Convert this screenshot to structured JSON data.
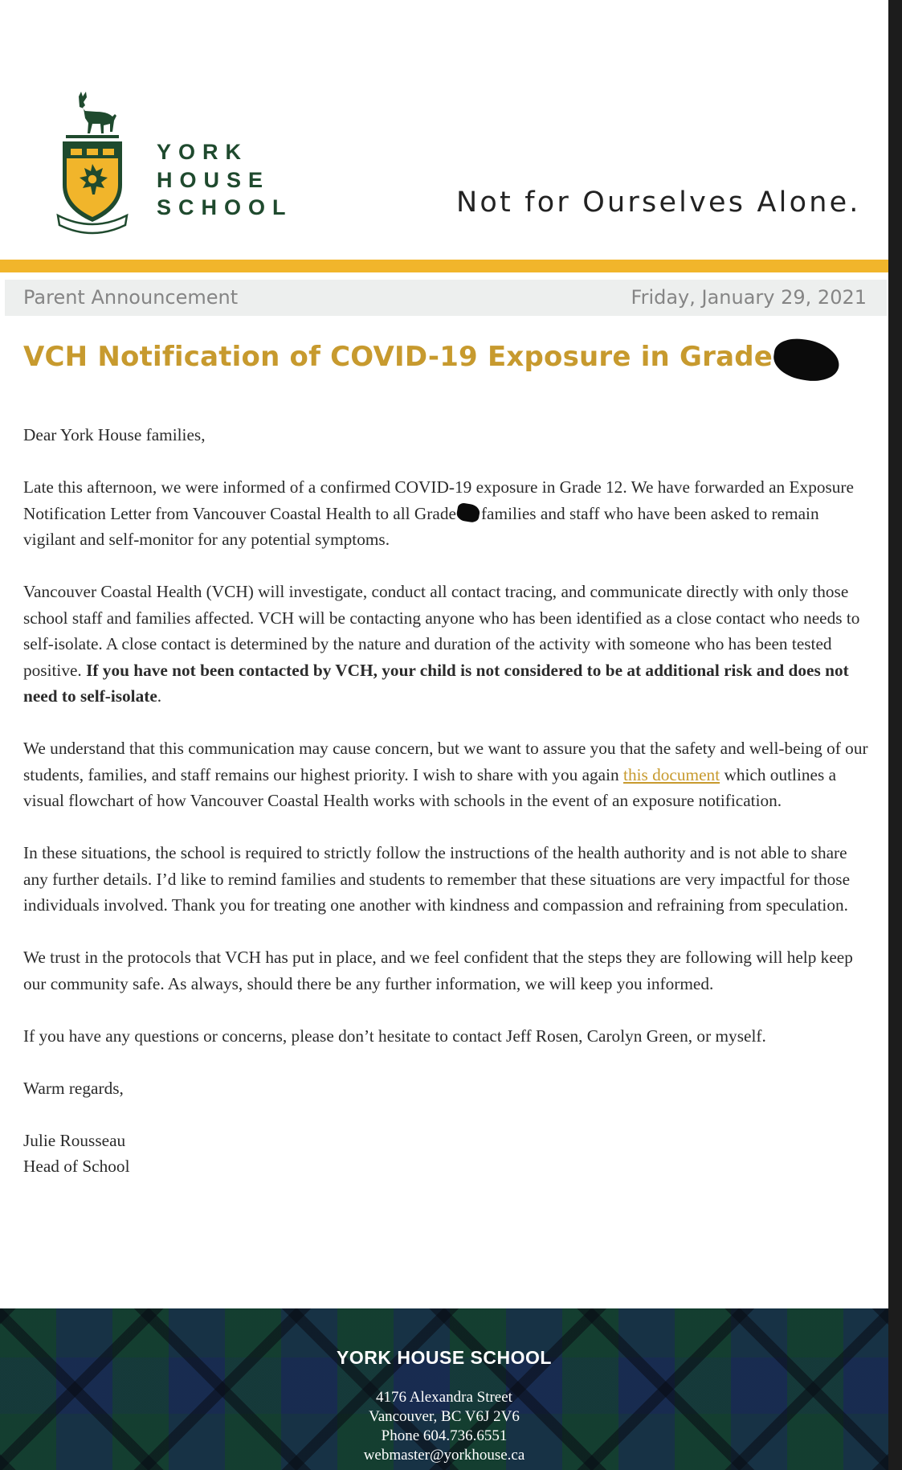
{
  "header": {
    "logo_lines": [
      "YORK",
      "HOUSE",
      "SCHOOL"
    ],
    "motto": "Not for Ourselves Alone."
  },
  "announcement_bar": {
    "label": "Parent Announcement",
    "date": "Friday, January 29, 2021"
  },
  "headline": "VCH Notification of COVID-19 Exposure in Grade",
  "body": {
    "greeting": "Dear York House families,",
    "p1_part1": "Late this afternoon, we were informed of a confirmed COVID-19 exposure in Grade 12. We have forwarded an Exposure Notification Letter from Vancouver Coastal Health to all Grade",
    "p1_part2": "families and staff who have been asked to remain vigilant and self-monitor for any potential symptoms.",
    "p2_text": "Vancouver Coastal Health (VCH) will investigate, conduct all contact tracing, and communicate directly with only those school staff and families affected. VCH will be contacting anyone who has been identified as a close contact who needs to self-isolate. A close contact is determined by the nature and duration of the activity with someone who has been tested positive.",
    "p2_bold": "If you have not been contacted by VCH, your child is not considered to be at additional risk and does not need to self-isolate",
    "p2_end": ".",
    "p3_part1": "We understand that this communication may cause concern, but we want to assure you that the safety and well-being of our students, families, and staff remains our highest priority. I wish to share with you again",
    "p3_link": "this document",
    "p3_part2": "which outlines a visual flowchart of how Vancouver Coastal Health works with schools in the event of an exposure notification.",
    "p4": "In these situations, the school is required to strictly follow the instructions of the health authority and is not able to share any further details. I’d like to remind families and students to remember that these situations are very impactful for those individuals involved. Thank you for treating one another with kindness and compassion and refraining from speculation.",
    "p5": "We trust in the protocols that VCH has put in place, and we feel confident that the steps they are following will help keep our community safe. As always, should there be any further information, we will keep you informed.",
    "p6": "If you have any questions or concerns, please don’t hesitate to contact Jeff Rosen, Carolyn Green, or myself.",
    "closing": "Warm regards,",
    "signer_name": "Julie Rousseau",
    "signer_title": "Head of School"
  },
  "footer": {
    "school_name": "YORK HOUSE SCHOOL",
    "address_line1": "4176 Alexandra Street",
    "address_line2": "Vancouver, BC V6J 2V6",
    "phone": "Phone 604.736.6551",
    "email": "webmaster@yorkhouse.ca"
  },
  "colors": {
    "gold_accent": "#f1b52b",
    "headline_gold": "#c79a2e",
    "school_green": "#1f4a2e",
    "footer_navy": "#16283a"
  }
}
